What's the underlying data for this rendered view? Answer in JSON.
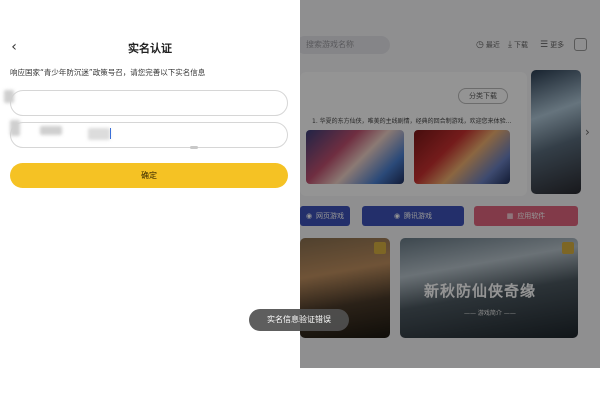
{
  "panel": {
    "back_icon": "chevron-left-icon",
    "title": "实名认证",
    "policy_note": "响应国家“青少年防沉迷”政策号召，请您完善以下实名信息",
    "name_field": {
      "value": "",
      "placeholder": ""
    },
    "id_field": {
      "value": "",
      "placeholder": ""
    },
    "confirm_label": "确定",
    "accent_color": "#f5c224"
  },
  "toast": {
    "message": "实名信息验证错误"
  },
  "background": {
    "search_placeholder": "搜索游戏名称",
    "toolbar": [
      {
        "icon": "clock-icon",
        "label": "最近"
      },
      {
        "icon": "download-icon",
        "label": "下载"
      },
      {
        "icon": "menu-icon",
        "label": "更多"
      }
    ],
    "section": {
      "rank_button": "分类下载",
      "description": "1. 华夏的东方仙侠，唯美的主线剧情，经典的回合制游戏，欢迎您来体验..."
    },
    "categories": [
      {
        "icon": "gamepad-icon",
        "label": "网页游戏",
        "color": "#3d52b8"
      },
      {
        "icon": "gamepad-icon",
        "label": "腾讯游戏",
        "color": "#3d52b8"
      },
      {
        "icon": "grid-icon",
        "label": "应用软件",
        "color": "#e0657f"
      }
    ],
    "featured": {
      "title": "新秋防仙侠奇缘",
      "subtitle": "—— 游戏简介 ——"
    }
  }
}
